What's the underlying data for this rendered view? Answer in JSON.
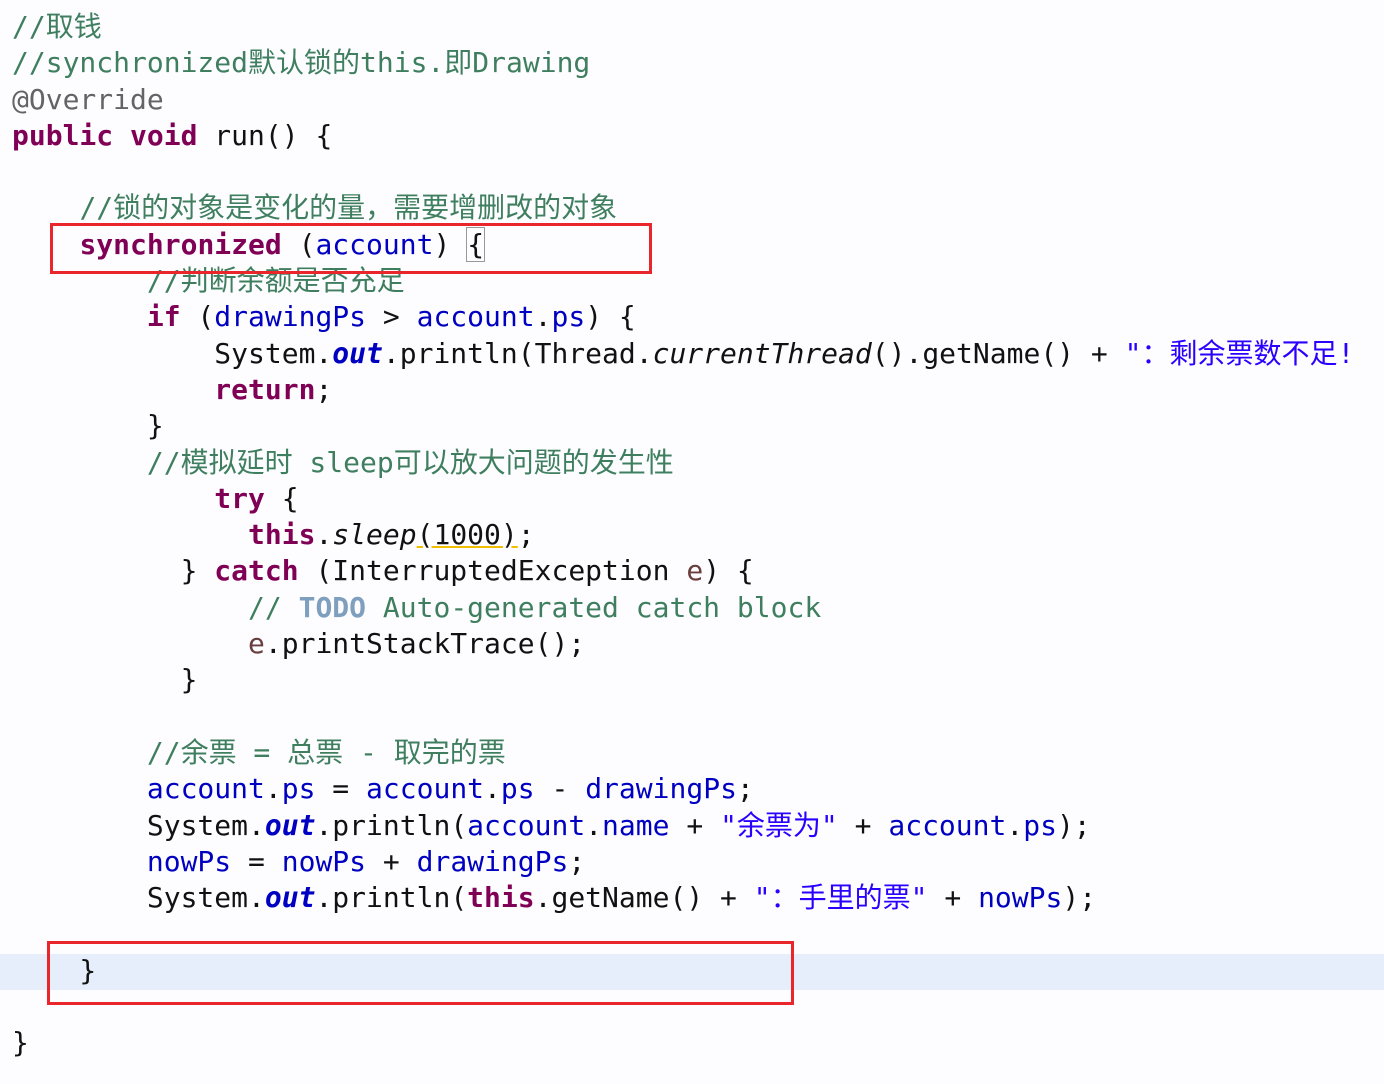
{
  "editor": {
    "current_line_index": 26,
    "lines": [
      [
        [
          "//取钱",
          "c"
        ]
      ],
      [
        [
          "//synchronized默认锁的this.即Drawing",
          "c"
        ]
      ],
      [
        [
          "@Override",
          "a"
        ]
      ],
      [
        [
          "public",
          "k"
        ],
        [
          " ",
          "p"
        ],
        [
          "void",
          "k"
        ],
        [
          " run() {",
          "p"
        ]
      ],
      [],
      [
        [
          "    ",
          "p"
        ],
        [
          "//锁的对象是变化的量，需要增删改的对象",
          "c"
        ]
      ],
      [
        [
          "    ",
          "p"
        ],
        [
          "synchronized",
          "k"
        ],
        [
          " (",
          "p"
        ],
        [
          "account",
          "f"
        ],
        [
          ") ",
          "p"
        ],
        [
          "{",
          "br"
        ]
      ],
      [
        [
          "        ",
          "p"
        ],
        [
          "//判断余额是否充足",
          "c"
        ]
      ],
      [
        [
          "        ",
          "p"
        ],
        [
          "if",
          "k"
        ],
        [
          " (",
          "p"
        ],
        [
          "drawingPs",
          "f"
        ],
        [
          " > ",
          "p"
        ],
        [
          "account",
          "f"
        ],
        [
          ".",
          "p"
        ],
        [
          "ps",
          "f"
        ],
        [
          ") {",
          "p"
        ]
      ],
      [
        [
          "            System.",
          "p"
        ],
        [
          "out",
          "fi"
        ],
        [
          ".println(Thread.",
          "p"
        ],
        [
          "currentThread",
          "m"
        ],
        [
          "().getName() + ",
          "p"
        ],
        [
          "\"：剩余票数不足!",
          "s"
        ]
      ],
      [
        [
          "            ",
          "p"
        ],
        [
          "return",
          "k"
        ],
        [
          ";",
          "p"
        ]
      ],
      [
        [
          "        }",
          "p"
        ]
      ],
      [
        [
          "        ",
          "p"
        ],
        [
          "//模拟延时 sleep可以放大问题的发生性",
          "c"
        ]
      ],
      [
        [
          "            ",
          "p"
        ],
        [
          "try",
          "k"
        ],
        [
          " {",
          "p"
        ]
      ],
      [
        [
          "              ",
          "p"
        ],
        [
          "this",
          "k"
        ],
        [
          ".",
          "p"
        ],
        [
          "sleep",
          "m"
        ],
        [
          "(1000)",
          "w"
        ],
        [
          ";",
          "p"
        ]
      ],
      [
        [
          "          } ",
          "p"
        ],
        [
          "catch",
          "k"
        ],
        [
          " (InterruptedException ",
          "p"
        ],
        [
          "e",
          "v"
        ],
        [
          ") {",
          "p"
        ]
      ],
      [
        [
          "              ",
          "p"
        ],
        [
          "// ",
          "c"
        ],
        [
          "TODO",
          "t"
        ],
        [
          " Auto-generated catch block",
          "c"
        ]
      ],
      [
        [
          "              ",
          "p"
        ],
        [
          "e",
          "v"
        ],
        [
          ".printStackTrace();",
          "p"
        ]
      ],
      [
        [
          "          }",
          "p"
        ]
      ],
      [],
      [
        [
          "        ",
          "p"
        ],
        [
          "//余票 = 总票 - 取完的票",
          "c"
        ]
      ],
      [
        [
          "        ",
          "p"
        ],
        [
          "account",
          "f"
        ],
        [
          ".",
          "p"
        ],
        [
          "ps",
          "f"
        ],
        [
          " = ",
          "p"
        ],
        [
          "account",
          "f"
        ],
        [
          ".",
          "p"
        ],
        [
          "ps",
          "f"
        ],
        [
          " - ",
          "p"
        ],
        [
          "drawingPs",
          "f"
        ],
        [
          ";",
          "p"
        ]
      ],
      [
        [
          "        System.",
          "p"
        ],
        [
          "out",
          "fi"
        ],
        [
          ".println(",
          "p"
        ],
        [
          "account",
          "f"
        ],
        [
          ".",
          "p"
        ],
        [
          "name",
          "f"
        ],
        [
          " + ",
          "p"
        ],
        [
          "\"余票为\"",
          "s"
        ],
        [
          " + ",
          "p"
        ],
        [
          "account",
          "f"
        ],
        [
          ".",
          "p"
        ],
        [
          "ps",
          "f"
        ],
        [
          ");",
          "p"
        ]
      ],
      [
        [
          "        ",
          "p"
        ],
        [
          "nowPs",
          "f"
        ],
        [
          " = ",
          "p"
        ],
        [
          "nowPs",
          "f"
        ],
        [
          " + ",
          "p"
        ],
        [
          "drawingPs",
          "f"
        ],
        [
          ";",
          "p"
        ]
      ],
      [
        [
          "        System.",
          "p"
        ],
        [
          "out",
          "fi"
        ],
        [
          ".println(",
          "p"
        ],
        [
          "this",
          "k"
        ],
        [
          ".getName() + ",
          "p"
        ],
        [
          "\"：手里的票\"",
          "s"
        ],
        [
          " + ",
          "p"
        ],
        [
          "nowPs",
          "f"
        ],
        [
          ");",
          "p"
        ]
      ],
      [],
      [
        [
          "    }",
          "p"
        ]
      ],
      [],
      [
        [
          "}",
          "p"
        ]
      ]
    ]
  },
  "annotations": {
    "highlight_color": "#e8262b"
  }
}
